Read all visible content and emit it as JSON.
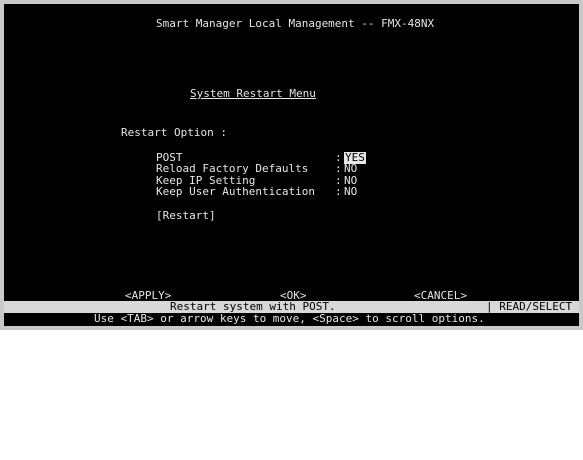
{
  "window_title": "Smart Manager Local Management -- FMX-48NX",
  "menu_title": "System Restart Menu",
  "section_label": "Restart Option :",
  "options": [
    {
      "label": "POST",
      "separator": ":",
      "value": "YES",
      "selected": true
    },
    {
      "label": "Reload Factory Defaults",
      "separator": ":",
      "value": "NO",
      "selected": false
    },
    {
      "label": "Keep IP Setting",
      "separator": ":",
      "value": "NO",
      "selected": false
    },
    {
      "label": "Keep User Authentication",
      "separator": ":",
      "value": "NO",
      "selected": false
    }
  ],
  "restart_button": "[Restart]",
  "buttons": {
    "apply": "<APPLY>",
    "ok": "<OK>",
    "cancel": "<CANCEL>"
  },
  "status_bar": {
    "message": "Restart system with POST.",
    "mode": "| READ/SELECT"
  },
  "help_text": "Use <TAB> or arrow keys to move, <Space> to scroll options.",
  "colors": {
    "background": "#000000",
    "foreground": "#e6e6e6",
    "status_bar_bg": "#d8d8d8",
    "frame": "#c9c9c9"
  }
}
